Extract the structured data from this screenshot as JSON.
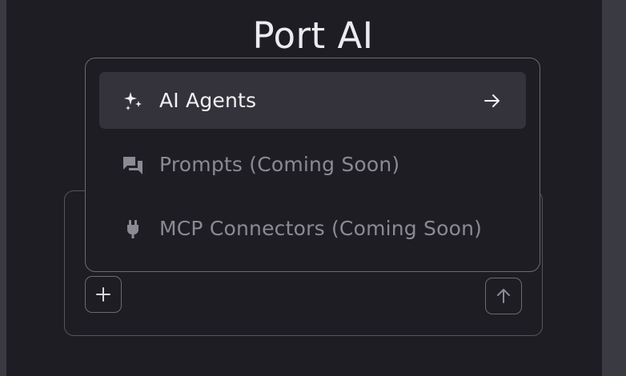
{
  "header": {
    "title": "Port AI"
  },
  "menu": {
    "items": [
      {
        "label": "AI Agents",
        "icon": "sparkles-icon",
        "state": "active",
        "trailing_icon": "arrow-right-icon"
      },
      {
        "label": "Prompts (Coming Soon)",
        "icon": "chat-bubbles-icon",
        "state": "disabled"
      },
      {
        "label": "MCP Connectors (Coming Soon)",
        "icon": "plug-icon",
        "state": "disabled"
      }
    ]
  },
  "composer": {
    "add_icon": "plus-icon",
    "send_icon": "arrow-up-icon"
  },
  "colors": {
    "background": "#1e1d23",
    "active_item": "#34333b",
    "border": "#6b6a72",
    "text_primary": "#f1f1f3",
    "text_disabled": "#8b8a92"
  }
}
